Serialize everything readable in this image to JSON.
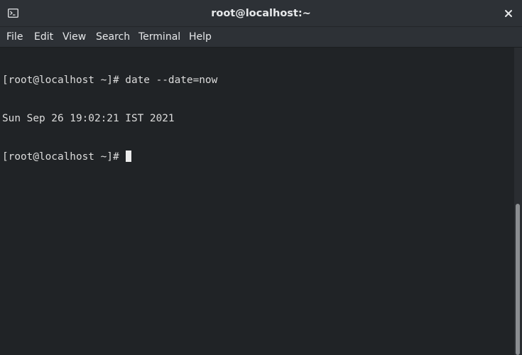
{
  "window": {
    "title": "root@localhost:~",
    "icon": "terminal-icon",
    "close_icon": "close-icon"
  },
  "menu": {
    "items": [
      {
        "label": "File"
      },
      {
        "label": "Edit"
      },
      {
        "label": "View"
      },
      {
        "label": "Search"
      },
      {
        "label": "Terminal"
      },
      {
        "label": "Help"
      }
    ]
  },
  "terminal": {
    "lines": [
      {
        "prompt": "[root@localhost ~]# ",
        "command": "date --date=now"
      },
      {
        "output": "Sun Sep 26 19:02:21 IST 2021"
      },
      {
        "prompt": "[root@localhost ~]# ",
        "command": ""
      }
    ]
  },
  "colors": {
    "background": "#202326",
    "text": "#dcdcdc",
    "chrome": "#2d3136"
  }
}
